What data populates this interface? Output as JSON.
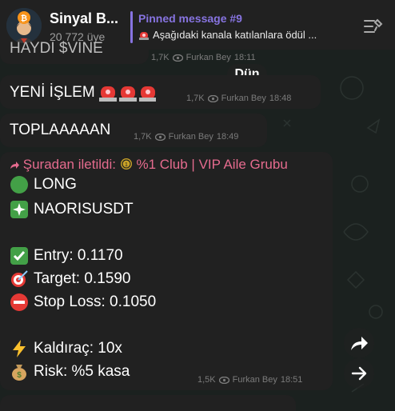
{
  "header": {
    "channel_title": "Sinyal B...",
    "subscribers": "20 772 üye",
    "pinned_title": "Pinned message #9",
    "pinned_text": "Aşağıdaki kanala katılanlara ödül ..."
  },
  "date_separator": "Dün",
  "messages": [
    {
      "text": "HAYDI $VINE",
      "views": "1,7K",
      "author": "Furkan Bey",
      "time": "18:11"
    },
    {
      "text": "YENİ İŞLEM",
      "views": "1,7K",
      "author": "Furkan Bey",
      "time": "18:48"
    },
    {
      "text": "TOPLAAAAAN",
      "views": "1,7K",
      "author": "Furkan Bey",
      "time": "18:49"
    }
  ],
  "signal": {
    "forwarded_prefix": "Şuradan iletildi:",
    "forwarded_source": "%1 Club | VIP Aile Grubu",
    "direction": "LONG",
    "pair": "NAORISUSDT",
    "entry": "Entry: 0.1170",
    "target": "Target: 0.1590",
    "stop_loss": "Stop Loss: 0.1050",
    "leverage": "Kaldıraç: 10x",
    "risk": "Risk: %5 kasa",
    "views": "1,5K",
    "author": "Furkan Bey",
    "time": "18:51"
  },
  "colors": {
    "accent": "#8774e1",
    "forward": "#e56b8e",
    "bubble": "#212121",
    "meta": "#7b7b7b"
  },
  "icons": [
    "bitcoin-avatar-icon",
    "pinned-list-icon",
    "eye-icon",
    "siren-icon",
    "green-circle-icon",
    "sparkle-icon",
    "check-icon",
    "target-icon",
    "no-entry-icon",
    "lightning-icon",
    "money-bag-icon",
    "share-icon",
    "arrow-right-icon"
  ]
}
